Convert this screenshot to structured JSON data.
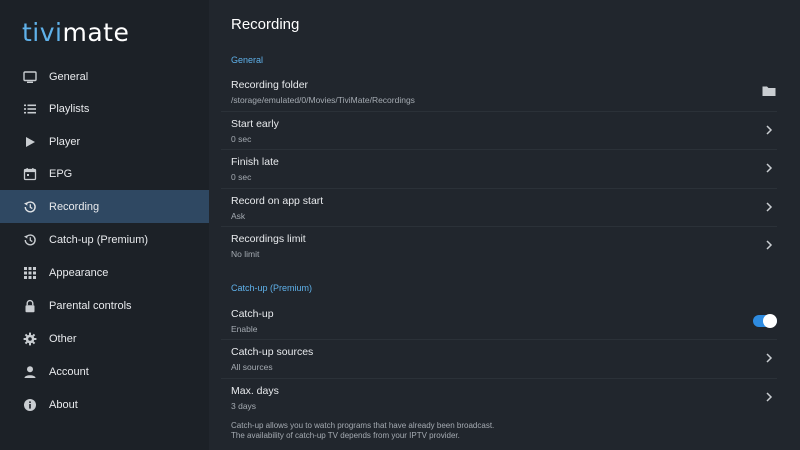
{
  "logo": {
    "part1": "tivi",
    "part2": "mate"
  },
  "sidebar": {
    "items": [
      {
        "label": "General",
        "icon": "tv-icon"
      },
      {
        "label": "Playlists",
        "icon": "list-icon"
      },
      {
        "label": "Player",
        "icon": "play-icon"
      },
      {
        "label": "EPG",
        "icon": "calendar-icon"
      },
      {
        "label": "Recording",
        "icon": "history-icon",
        "active": true
      },
      {
        "label": "Catch-up (Premium)",
        "icon": "history-icon"
      },
      {
        "label": "Appearance",
        "icon": "grid-icon"
      },
      {
        "label": "Parental controls",
        "icon": "lock-icon"
      },
      {
        "label": "Other",
        "icon": "gear-icon"
      },
      {
        "label": "Account",
        "icon": "person-icon"
      },
      {
        "label": "About",
        "icon": "info-icon"
      }
    ]
  },
  "main": {
    "title": "Recording",
    "sections": [
      {
        "header": "General",
        "rows": [
          {
            "title": "Recording folder",
            "value": "/storage/emulated/0/Movies/TiviMate/Recordings",
            "action": "folder-icon"
          },
          {
            "title": "Start early",
            "value": "0 sec",
            "action": "chevron-right-icon"
          },
          {
            "title": "Finish late",
            "value": "0 sec",
            "action": "chevron-right-icon"
          },
          {
            "title": "Record on app start",
            "value": "Ask",
            "action": "chevron-right-icon"
          },
          {
            "title": "Recordings limit",
            "value": "No limit",
            "action": "chevron-right-icon"
          }
        ]
      },
      {
        "header": "Catch-up (Premium)",
        "rows": [
          {
            "title": "Catch-up",
            "value": "Enable",
            "action": "toggle",
            "toggle_on": true
          },
          {
            "title": "Catch-up sources",
            "value": "All sources",
            "action": "chevron-right-icon"
          },
          {
            "title": "Max. days",
            "value": "3 days",
            "action": "chevron-right-icon"
          }
        ]
      }
    ],
    "footnote_line1": "Catch-up allows you to watch programs that have already been broadcast.",
    "footnote_line2": "The availability of catch-up TV depends from your IPTV provider."
  },
  "colors": {
    "accent": "#5fb1ea",
    "active_item_bg": "#2f4862",
    "toggle_on": "#2e8be0"
  }
}
